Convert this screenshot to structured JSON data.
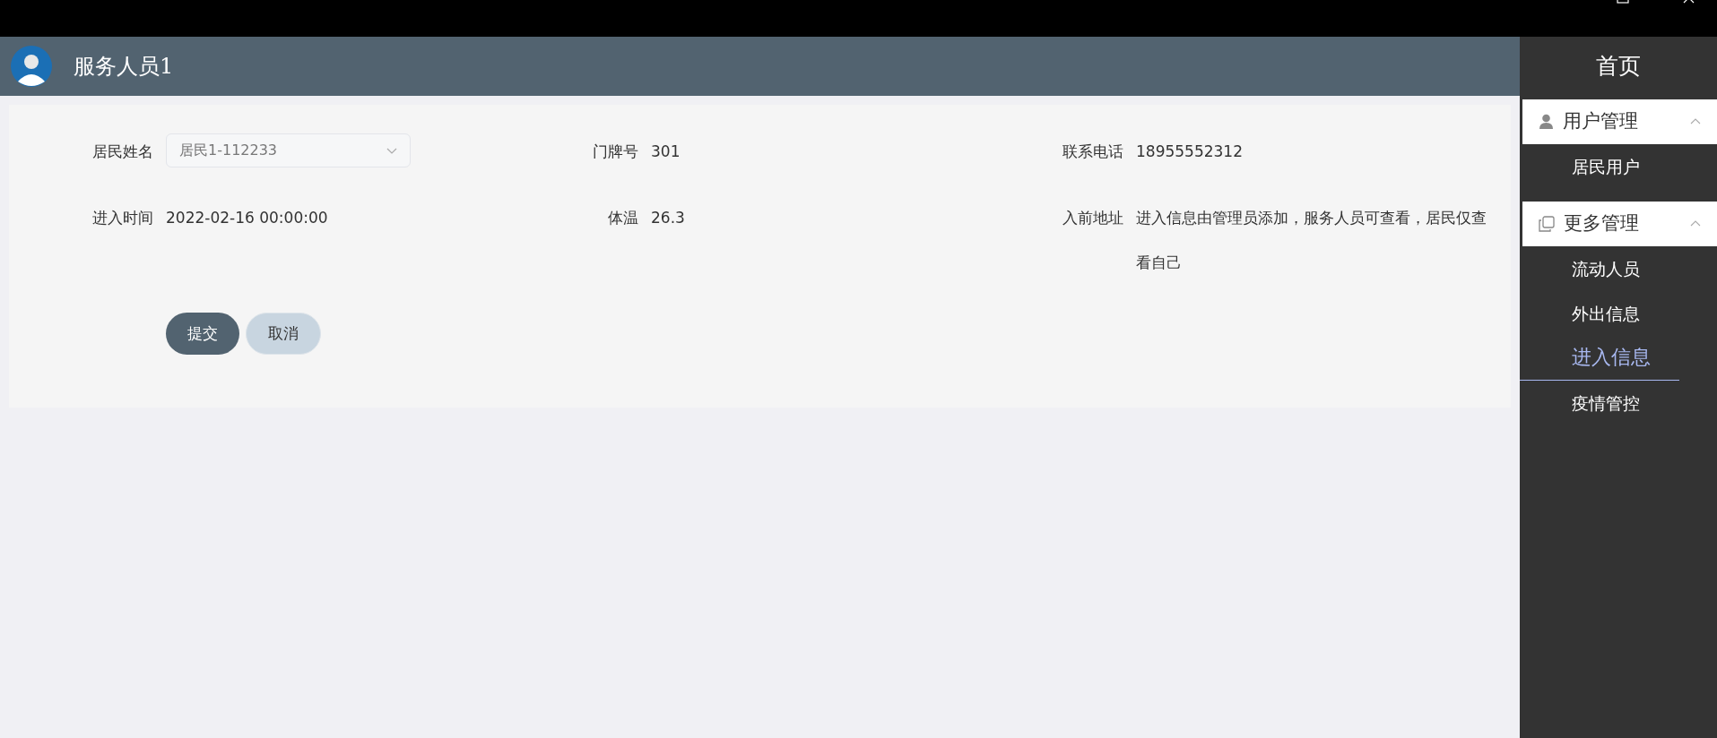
{
  "header": {
    "title": "服务人员1"
  },
  "form": {
    "fields": [
      {
        "kind": "select",
        "label": "居民姓名",
        "value": "居民1-112233"
      },
      {
        "kind": "text",
        "label": "门牌号",
        "value": "301"
      },
      {
        "kind": "text",
        "label": "联系电话",
        "value": "18955552312"
      },
      {
        "kind": "text",
        "label": "进入时间",
        "value": "2022-02-16 00:00:00"
      },
      {
        "kind": "text",
        "label": "体温",
        "value": "26.3"
      },
      {
        "kind": "text",
        "label": "入前地址",
        "value": "进入信息由管理员添加，服务人员可查看，居民仅查看自己"
      }
    ],
    "buttons": [
      {
        "kind": "primary",
        "label": "提交"
      },
      {
        "kind": "secondary",
        "label": "取消"
      }
    ]
  },
  "sidebar": {
    "home": "首页",
    "groups": [
      {
        "label": "用户管理",
        "expanded": true,
        "items": [
          {
            "label": "居民用户",
            "selected": false
          }
        ]
      },
      {
        "label": "更多管理",
        "expanded": true,
        "items": [
          {
            "label": "流动人员",
            "selected": false
          },
          {
            "label": "外出信息",
            "selected": false
          },
          {
            "label": "进入信息",
            "selected": true
          },
          {
            "label": "疫情管控",
            "selected": false
          }
        ]
      }
    ]
  }
}
